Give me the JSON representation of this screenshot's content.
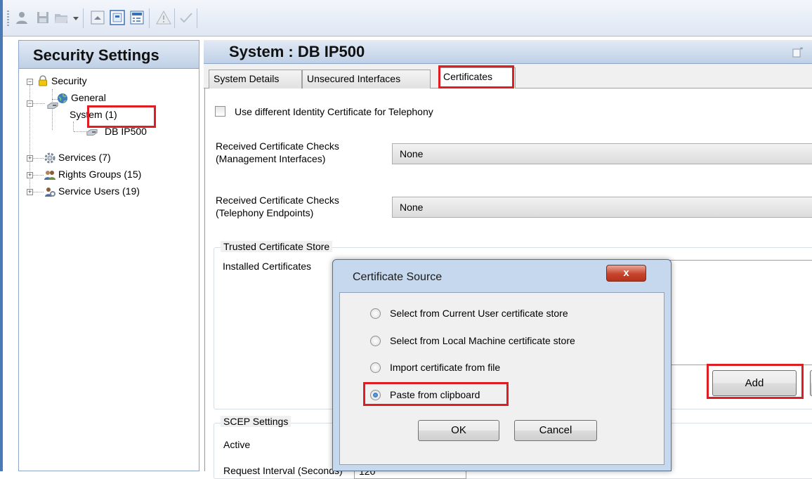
{
  "left_pane": {
    "title": "Security Settings",
    "tree": [
      {
        "label": "Security"
      },
      {
        "label": "General"
      },
      {
        "label": "System (1)"
      },
      {
        "label": "DB IP500"
      },
      {
        "label": "Services (7)"
      },
      {
        "label": "Rights Groups (15)"
      },
      {
        "label": "Service Users (19)"
      }
    ]
  },
  "right_pane": {
    "title": "System :  DB IP500",
    "tabs": [
      {
        "label": "System Details"
      },
      {
        "label": "Unsecured Interfaces"
      },
      {
        "label": "Certificates"
      }
    ],
    "certificates": {
      "use_different_identity": "Use different Identity Certificate for Telephony",
      "mgmt_checks_label_1": "Received Certificate Checks",
      "mgmt_checks_label_2": "(Management Interfaces)",
      "mgmt_checks_value": "None",
      "tel_checks_label_1": "Received Certificate Checks",
      "tel_checks_label_2": "(Telephony Endpoints)",
      "tel_checks_value": "None",
      "trusted_store_title": "Trusted Certificate Store",
      "installed_certificates_label": "Installed Certificates",
      "add_button": "Add",
      "scep_title": "SCEP Settings",
      "scep_active_label": "Active",
      "scep_request_interval_label": "Request Interval (Seconds)",
      "scep_request_interval_value": "120"
    }
  },
  "dialog": {
    "title": "Certificate Source",
    "close_label": "x",
    "options": [
      {
        "label": "Select from Current User certificate store",
        "checked": false
      },
      {
        "label": "Select from Local Machine certificate store",
        "checked": false
      },
      {
        "label": "Import certificate from file",
        "checked": false
      },
      {
        "label": "Paste from clipboard",
        "checked": true
      }
    ],
    "ok_label": "OK",
    "cancel_label": "Cancel"
  },
  "colors": {
    "highlight": "#e11d24",
    "header_gradient_top": "#e2eaf5",
    "header_gradient_bottom": "#bfd0e6"
  }
}
